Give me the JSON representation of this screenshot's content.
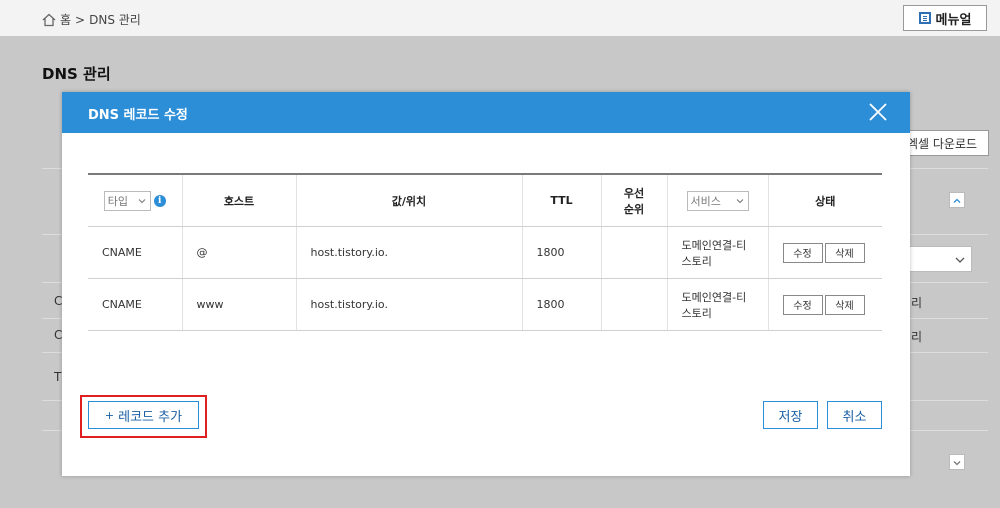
{
  "breadcrumb": {
    "home": "홈",
    "separator": ">",
    "current": "DNS 관리"
  },
  "header": {
    "manual_label": "메뉴얼"
  },
  "page": {
    "title": "DNS 관리",
    "excel_download": "엑셀 다운로드"
  },
  "background_rows": [
    {
      "first": "C",
      "last": "리"
    },
    {
      "first": "C",
      "last": "리"
    },
    {
      "first": "T",
      "last": ""
    }
  ],
  "modal": {
    "title": "DNS 레코드 수정",
    "columns": {
      "type_select": "타입",
      "host": "호스트",
      "value": "값/위치",
      "ttl": "TTL",
      "priority_line1": "우선",
      "priority_line2": "순위",
      "service_select": "서비스",
      "status": "상태"
    },
    "rows": [
      {
        "type": "CNAME",
        "host": "@",
        "value": "host.tistory.io.",
        "ttl": "1800",
        "priority": "",
        "service_line1": "도메인연결-티",
        "service_line2": "스토리",
        "edit": "수정",
        "delete": "삭제"
      },
      {
        "type": "CNAME",
        "host": "www",
        "value": "host.tistory.io.",
        "ttl": "1800",
        "priority": "",
        "service_line1": "도메인연결-티",
        "service_line2": "스토리",
        "edit": "수정",
        "delete": "삭제"
      }
    ],
    "add_record_plus": "+",
    "add_record": "레코드 추가",
    "save": "저장",
    "cancel": "취소"
  },
  "colors": {
    "header_blue": "#2d8ed8",
    "highlight_red": "#e02020",
    "button_text": "#1a5fa5"
  },
  "icons": {
    "home": "home-icon",
    "manual": "document-icon",
    "close": "close-icon",
    "info": "info-icon",
    "chevron": "chevron-down-icon"
  }
}
